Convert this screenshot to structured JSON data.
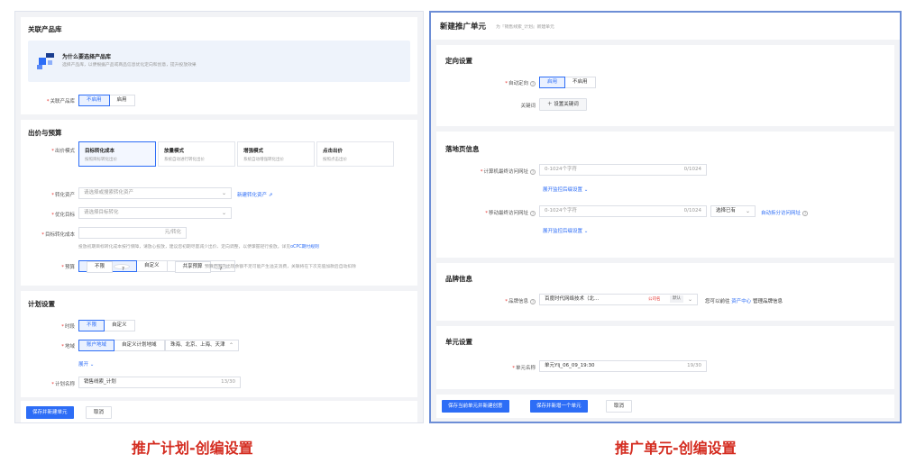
{
  "plan": {
    "product": {
      "title": "关联产品库",
      "banner_title": "为什么要选择产品库",
      "banner_desc": "选择产品库，以便根据产品或商品信息优化定向和创意，提升投放效果",
      "field_label": "关联产品库",
      "options": [
        "不启用",
        "启用"
      ]
    },
    "bidding": {
      "title": "出价与预算",
      "mode_label": "出价模式",
      "modes": [
        {
          "name": "目标转化成本",
          "desc": "按照目标转化出价"
        },
        {
          "name": "放量模式",
          "desc": "系统自动进行转化出价"
        },
        {
          "name": "增强模式",
          "desc": "系统自动增强转化出价"
        },
        {
          "name": "点击出价",
          "desc": "按照点击出价"
        }
      ],
      "asset_label": "转化资产",
      "asset_placeholder": "请选择或搜索转化资产",
      "asset_link": "新建转化资产",
      "opt_label": "优化目标",
      "opt_placeholder": "请选择目标转化",
      "cost_label": "目标转化成本",
      "cost_unit": "元/转化",
      "cost_hint_prefix": "投放初期目标转化成本按行保障，请放心投放，建议您初期尽量减少出价、定向调整，以便掌握轻行投放。详见",
      "cost_hint_link": "oCPC期付规则",
      "budget_label": "预算",
      "budget_options": [
        "不限",
        "自定义",
        "共享预算"
      ],
      "budget_hint": "预算范围内出现余额不足可能产生溢支消费，关联将在下次充值加款后自动扣除"
    },
    "schedule": {
      "title": "计划设置",
      "time_label": "时段",
      "time_options": [
        "不限",
        "自定义"
      ],
      "region_label": "地域",
      "region_options": [
        "账户地域",
        "自定义计划地域"
      ],
      "region_value": "珠海、北京、上海、天津",
      "expand": "展开",
      "name_label": "计划名称",
      "name_value": "销售线索_计划",
      "name_count": "13/30"
    },
    "footer": {
      "save": "保存并新建单元",
      "cancel": "取消"
    }
  },
  "unit": {
    "header_title": "新建推广单元",
    "header_sub": "为『销售线索_计划』新建单元",
    "targeting": {
      "title": "定向设置",
      "auto_label": "自动定向",
      "auto_options": [
        "启用",
        "不启用"
      ],
      "keyword_label": "关键词",
      "keyword_btn": "设置关键词"
    },
    "landing": {
      "title": "落地页信息",
      "pc_label": "计算机最终访问网址",
      "pc_placeholder": "0-1024个字符",
      "pc_count": "0/1024",
      "expand1": "展开监控后缀设置",
      "mobile_label": "移动最终访问网址",
      "mobile_placeholder": "0-1024个字符",
      "mobile_count": "0/1024",
      "select_existing": "选择已有",
      "auto_split": "自动拆分访问网址",
      "expand2": "展开监控后缀设置"
    },
    "brand": {
      "title": "品牌信息",
      "label": "品牌信息",
      "value": "百度时代网络技术（北...",
      "tag_red": "公司名",
      "tag_default": "默认",
      "note_prefix": "您可以前往",
      "note_link": "资产中心",
      "note_suffix": "管理品牌信息"
    },
    "unit_settings": {
      "title": "单元设置",
      "name_label": "单元名称",
      "name_value": "单元Ylj_06_09_19:30",
      "name_count": "19/30"
    },
    "footer": {
      "save_creative": "保存当前单元并新建创意",
      "save_new": "保存并新增一个单元",
      "cancel": "取消"
    }
  },
  "captions": {
    "left": "推广计划-创编设置",
    "right": "推广单元-创编设置"
  }
}
